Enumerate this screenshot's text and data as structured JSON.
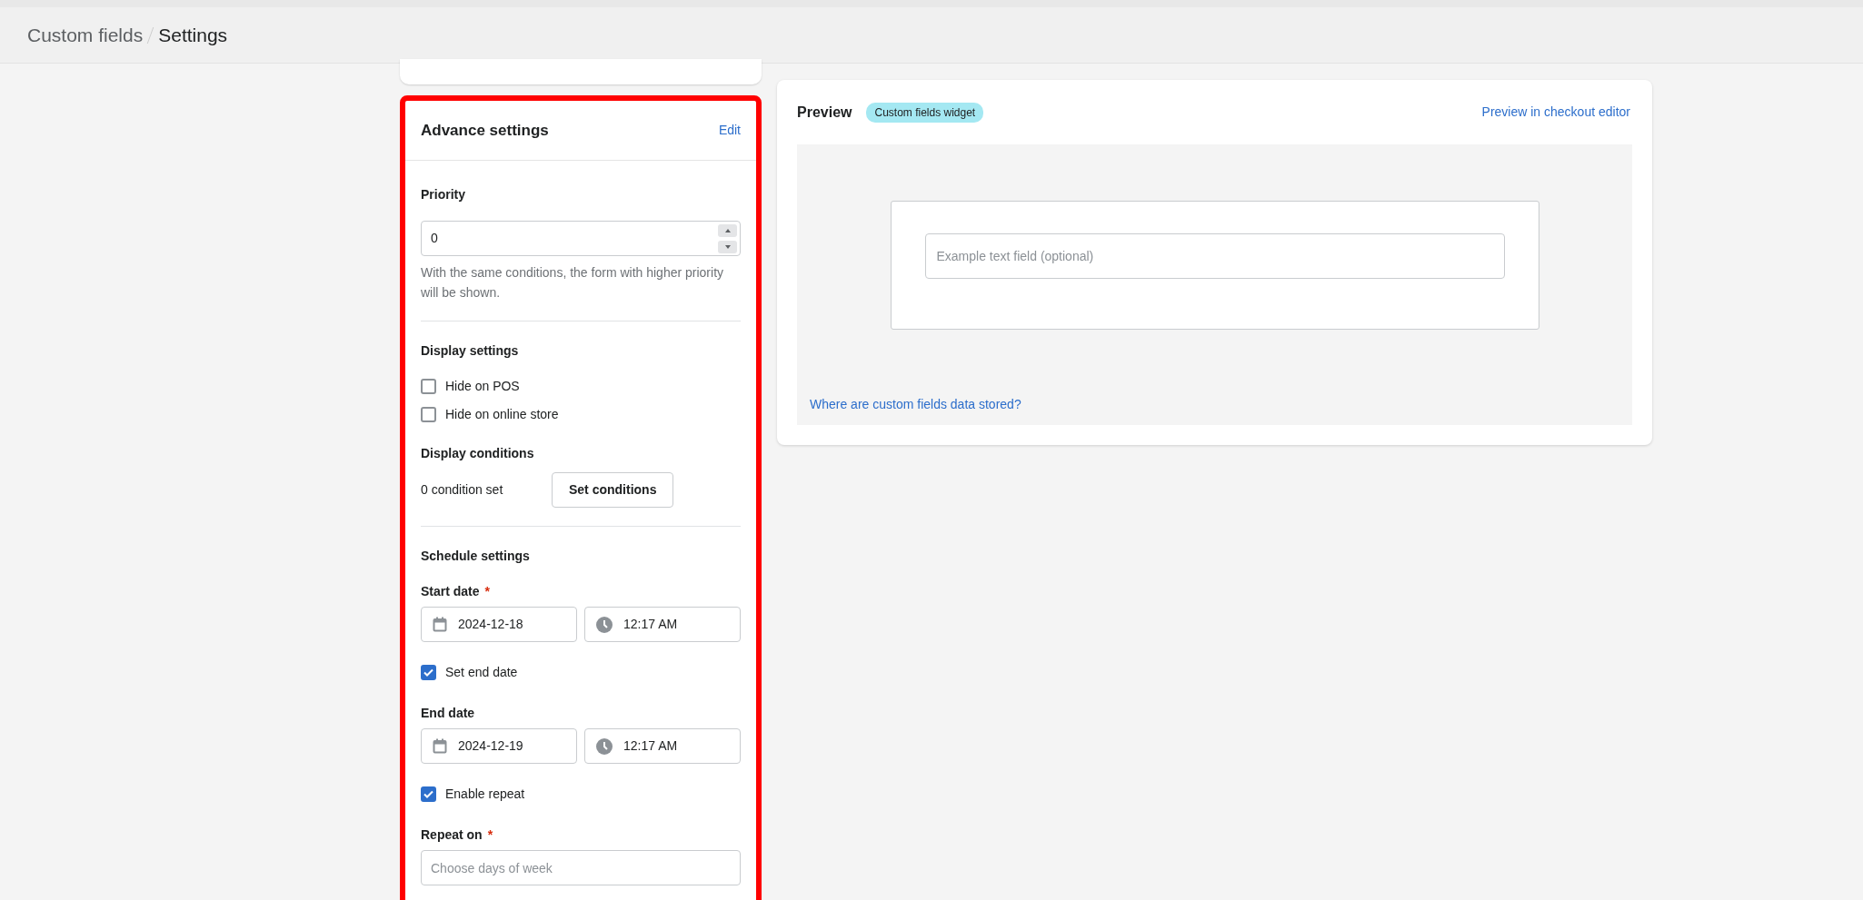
{
  "breadcrumb": [
    {
      "label": "Custom fields",
      "current": false
    },
    {
      "label": "Settings",
      "current": true
    }
  ],
  "advance_settings": {
    "title": "Advance settings",
    "edit_link": "Edit",
    "highlighted": true,
    "priority": {
      "label": "Priority",
      "value": "0",
      "help": "With the same conditions, the form with higher priority will be shown."
    },
    "display_settings": {
      "title": "Display settings",
      "options": [
        {
          "label": "Hide on POS",
          "checked": false
        },
        {
          "label": "Hide on online store",
          "checked": false
        }
      ]
    },
    "display_conditions": {
      "title": "Display conditions",
      "count_text": "0 condition set",
      "button": "Set conditions"
    },
    "schedule": {
      "title": "Schedule settings",
      "start_date": {
        "label": "Start date",
        "required_mark": "*",
        "date": "2024-12-18",
        "time": "12:17 AM"
      },
      "set_end_date": {
        "label": "Set end date",
        "checked": true
      },
      "end_date": {
        "label": "End date",
        "date": "2024-12-19",
        "time": "12:17 AM"
      },
      "enable_repeat": {
        "label": "Enable repeat",
        "checked": true
      },
      "repeat_on": {
        "label": "Repeat on",
        "required_mark": "*",
        "placeholder": "Choose days of week"
      }
    }
  },
  "preview": {
    "title": "Preview",
    "badge": "Custom fields widget",
    "link": "Preview in checkout editor",
    "field_placeholder": "Example text field (optional)",
    "help_link": "Where are custom fields data stored?"
  }
}
